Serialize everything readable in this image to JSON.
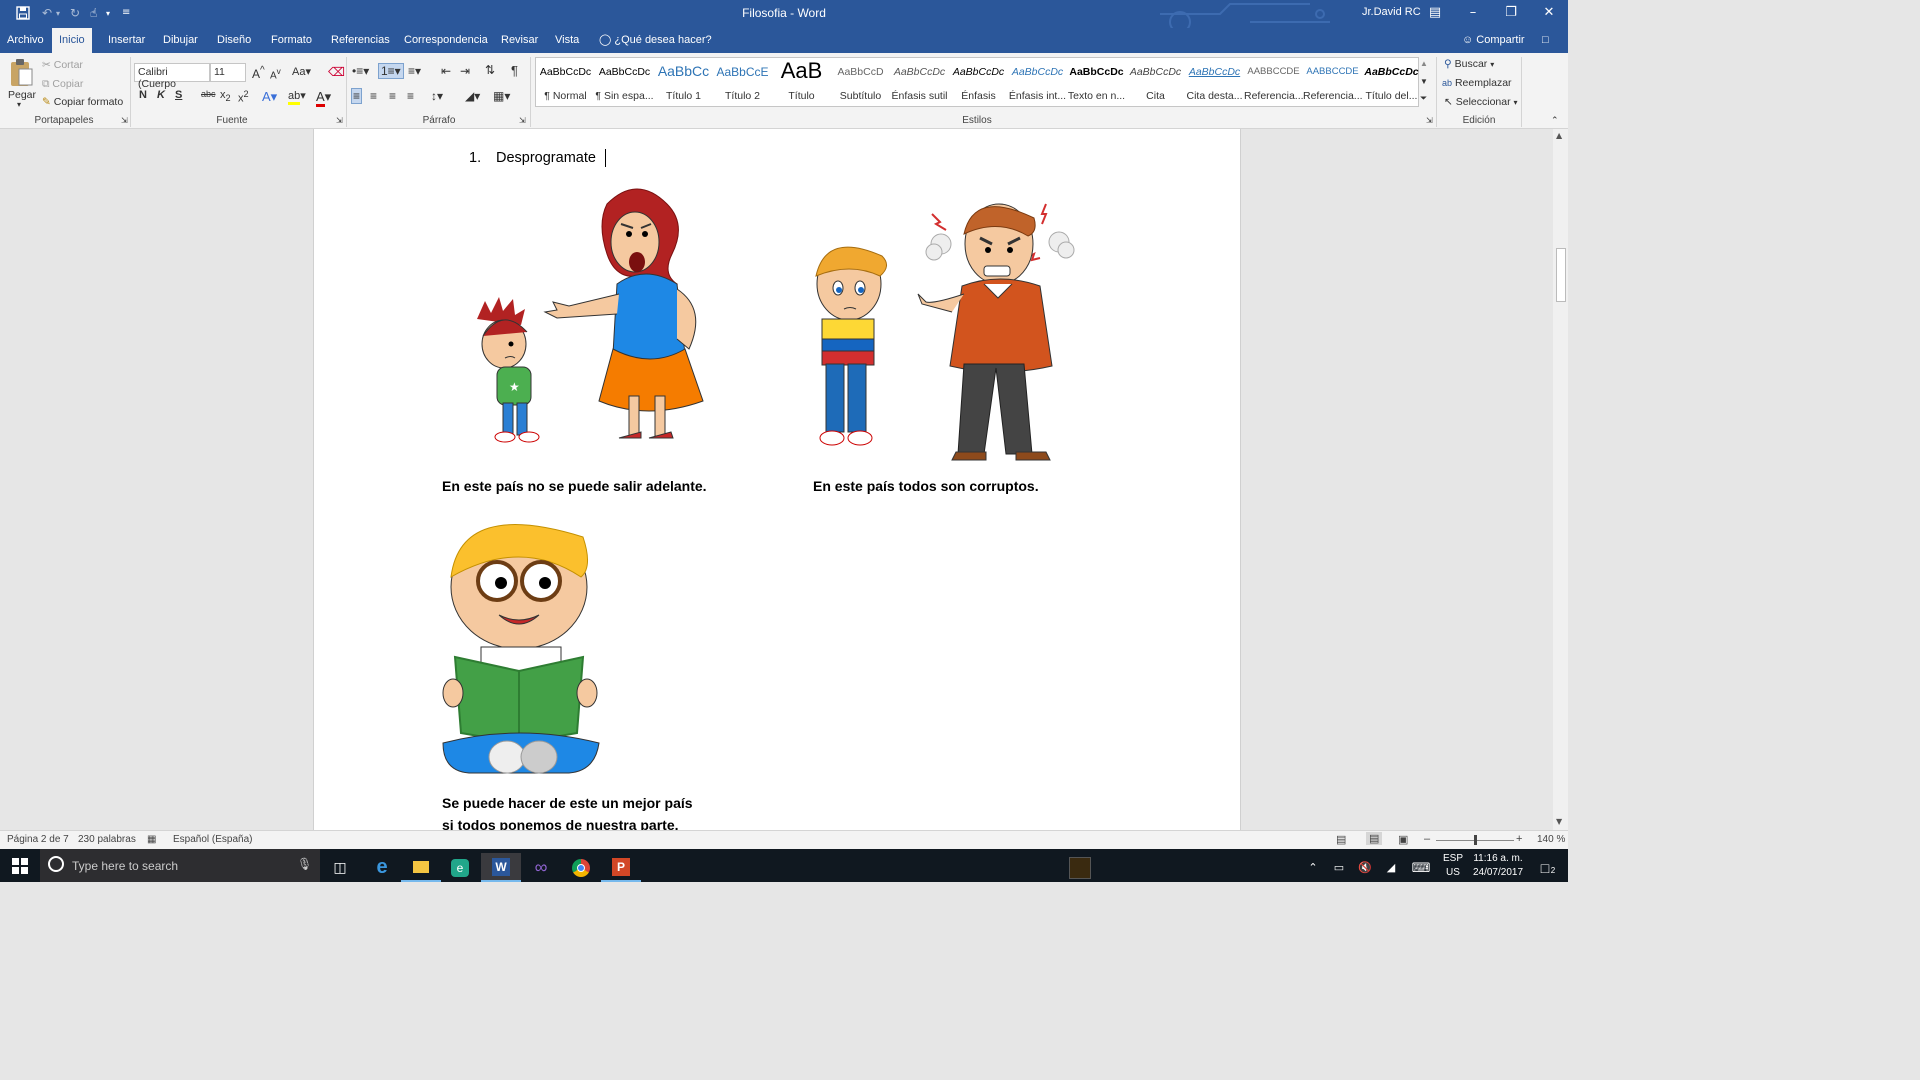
{
  "titlebar": {
    "title": "Filosofia  -  Word",
    "user": "Jr.David RC"
  },
  "tabs": [
    "Archivo",
    "Inicio",
    "Insertar",
    "Dibujar",
    "Diseño",
    "Formato",
    "Referencias",
    "Correspondencia",
    "Revisar",
    "Vista"
  ],
  "tell_me": "¿Qué desea hacer?",
  "share_label": "Compartir",
  "clipboard": {
    "paste": "Pegar",
    "cut": "Cortar",
    "copy": "Copiar",
    "format_painter": "Copiar formato",
    "group": "Portapapeles"
  },
  "font": {
    "family": "Calibri (Cuerpo",
    "size": "11",
    "group": "Fuente",
    "bold": "N",
    "italic": "K",
    "underline": "S"
  },
  "paragraph": {
    "group": "Párrafo"
  },
  "styles": {
    "group": "Estilos",
    "items": [
      {
        "sample": "AaBbCcDc",
        "name": "¶ Normal"
      },
      {
        "sample": "AaBbCcDc",
        "name": "¶ Sin espa..."
      },
      {
        "sample": "AaBbCc",
        "name": "Título 1"
      },
      {
        "sample": "AaBbCcE",
        "name": "Título 2"
      },
      {
        "sample": "AaB",
        "name": "Título"
      },
      {
        "sample": "AaBbCcD",
        "name": "Subtítulo"
      },
      {
        "sample": "AaBbCcDc",
        "name": "Énfasis sutil"
      },
      {
        "sample": "AaBbCcDc",
        "name": "Énfasis"
      },
      {
        "sample": "AaBbCcDc",
        "name": "Énfasis int..."
      },
      {
        "sample": "AaBbCcDc",
        "name": "Texto en n..."
      },
      {
        "sample": "AaBbCcDc",
        "name": "Cita"
      },
      {
        "sample": "AaBbCcDc",
        "name": "Cita desta..."
      },
      {
        "sample": "AABBCCDE",
        "name": "Referencia..."
      },
      {
        "sample": "AABBCCDE",
        "name": "Referencia..."
      },
      {
        "sample": "AaBbCcDc",
        "name": "Título del..."
      }
    ]
  },
  "editing": {
    "find": "Buscar",
    "replace": "Reemplazar",
    "select": "Seleccionar",
    "group": "Edición"
  },
  "document": {
    "list_number": "1.",
    "heading": "Desprogramate",
    "caption1": "En este país no se puede salir adelante.",
    "caption2": "En este país todos son corruptos.",
    "caption3_line1": "Se puede hacer de este un mejor país",
    "caption3_line2": "si todos ponemos de nuestra parte."
  },
  "status": {
    "page": "Página 2 de 7",
    "words": "230 palabras",
    "language": "Español (España)",
    "zoom": "140 %"
  },
  "taskbar": {
    "search_placeholder": "Type here to search",
    "lang1": "ESP",
    "lang2": "US",
    "time": "11:16 a. m.",
    "date": "24/07/2017",
    "notifications": "2"
  },
  "colors": {
    "word_blue": "#2b579a",
    "ribbon_bg": "#f3f3f3",
    "taskbar_bg": "#101820"
  }
}
